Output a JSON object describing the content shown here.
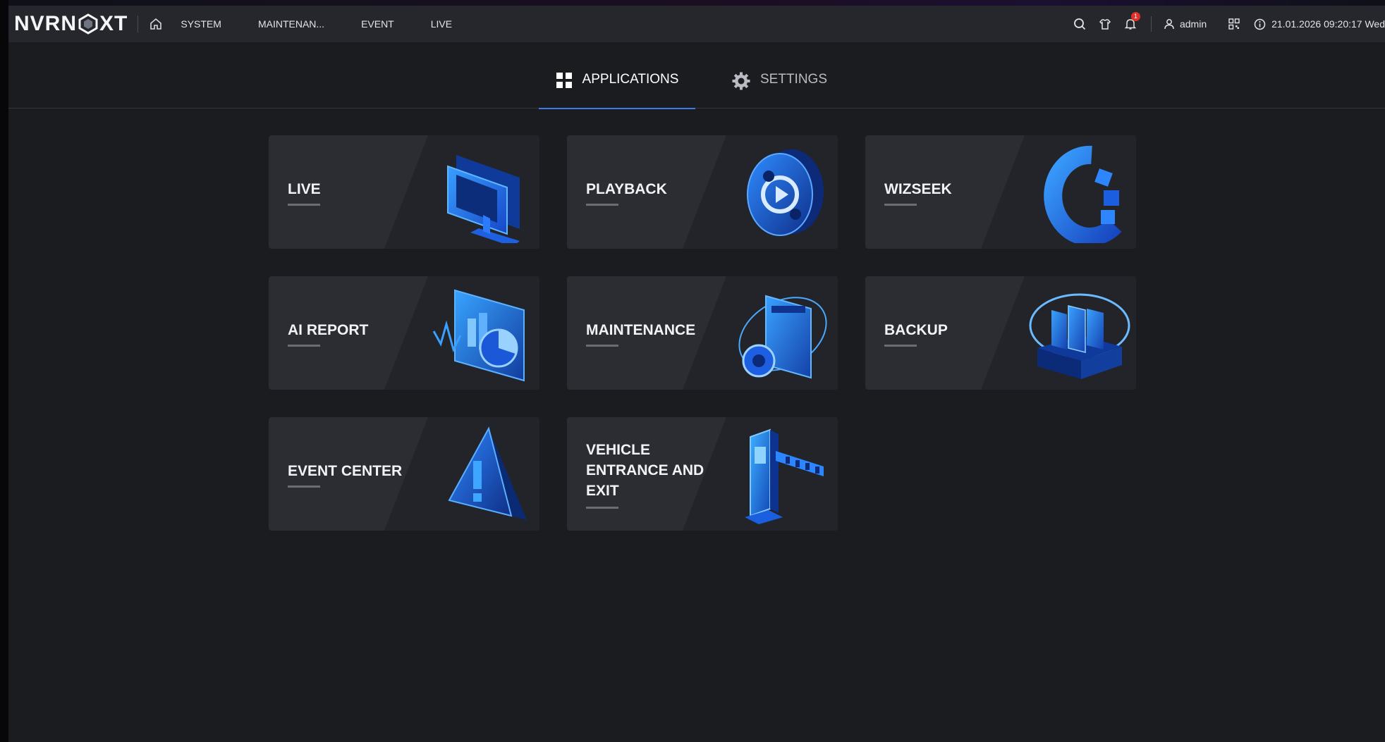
{
  "topbar": {
    "logo_text_left": "NVRN",
    "logo_text_right": "XT",
    "nav": [
      "SYSTEM",
      "MAINTENAN...",
      "EVENT",
      "LIVE"
    ],
    "notification_count": "1",
    "user": "admin",
    "datetime": "21.01.2026 09:20:17 Wed"
  },
  "tabs": {
    "applications": "APPLICATIONS",
    "settings": "SETTINGS"
  },
  "apps": [
    {
      "label": "LIVE"
    },
    {
      "label": "PLAYBACK"
    },
    {
      "label": "WIZSEEK"
    },
    {
      "label": "AI REPORT"
    },
    {
      "label": "MAINTENANCE"
    },
    {
      "label": "BACKUP"
    },
    {
      "label": "EVENT CENTER"
    },
    {
      "label": "VEHICLE ENTRANCE AND EXIT"
    }
  ],
  "colors": {
    "accent": "#3d7cf0",
    "icon_blue": "#2e7bff",
    "badge": "#e0302a"
  },
  "icons": [
    "home-icon",
    "search-icon",
    "shirt-icon",
    "bell-icon",
    "user-icon",
    "qr-icon",
    "info-icon",
    "apps-grid-icon",
    "gear-icon"
  ]
}
